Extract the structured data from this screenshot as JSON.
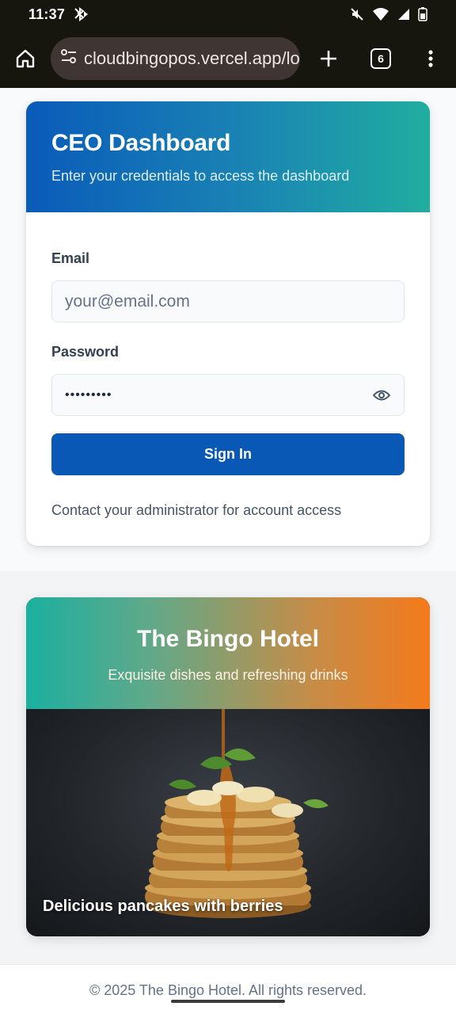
{
  "status_bar": {
    "time": "11:37"
  },
  "browser": {
    "url": "cloudbingopos.vercel.app/login",
    "tab_count": "6"
  },
  "login": {
    "title": "CEO Dashboard",
    "subtitle": "Enter your credentials to access the dashboard",
    "email_label": "Email",
    "email_placeholder": "your@email.com",
    "password_label": "Password",
    "password_value": "•••••••••",
    "sign_in_label": "Sign In",
    "contact_text": "Contact your administrator for account access"
  },
  "hotel": {
    "title": "The Bingo Hotel",
    "subtitle": "Exquisite dishes and refreshing drinks",
    "image_caption": "Delicious pancakes with berries"
  },
  "footer": {
    "text": "© 2025 The Bingo Hotel. All rights reserved."
  },
  "colors": {
    "primary": "#0a58b6",
    "teal": "#20aea0",
    "orange": "#f57a1c"
  }
}
